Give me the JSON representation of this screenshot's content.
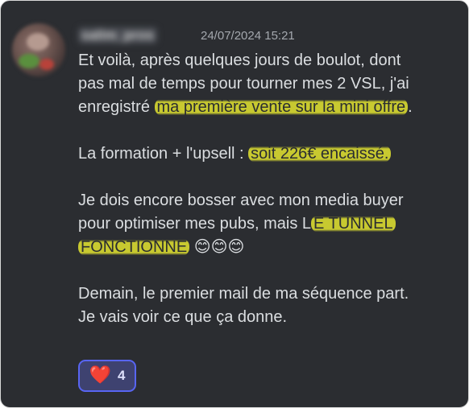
{
  "message": {
    "author": "salim_pros",
    "timestamp": "24/07/2024 15:21",
    "lines": [
      {
        "segments": [
          {
            "text": "Et voilà, après quelques jours de boulot, dont",
            "highlight": false
          }
        ]
      },
      {
        "segments": [
          {
            "text": "pas mal de temps pour tourner mes 2 VSL, j'ai",
            "highlight": false
          }
        ]
      },
      {
        "segments": [
          {
            "text": "enregistré ",
            "highlight": false
          },
          {
            "text": "ma première vente sur la mini offre",
            "highlight": true
          },
          {
            "text": ".",
            "highlight": false
          }
        ]
      },
      {
        "blank": true
      },
      {
        "segments": [
          {
            "text": "La formation + l'upsell : ",
            "highlight": false
          },
          {
            "text": "soit 226€ encaissé.",
            "highlight": true
          }
        ]
      },
      {
        "blank": true
      },
      {
        "segments": [
          {
            "text": "Je dois encore bosser avec mon media buyer",
            "highlight": false
          }
        ]
      },
      {
        "segments": [
          {
            "text": "pour optimiser mes pubs,  mais L",
            "highlight": false
          },
          {
            "text": "E TUNNEL",
            "highlight": true
          }
        ]
      },
      {
        "segments": [
          {
            "text": "FONCTIONNE",
            "highlight": true
          },
          {
            "text": " 😊😊😊",
            "highlight": false
          }
        ]
      },
      {
        "blank": true
      },
      {
        "segments": [
          {
            "text": "Demain, le premier mail de ma séquence part.",
            "highlight": false
          }
        ]
      },
      {
        "segments": [
          {
            "text": "Je vais voir ce que ça donne.",
            "highlight": false
          }
        ]
      }
    ]
  },
  "reaction": {
    "icon": "heart-icon",
    "emoji": "❤️",
    "count": "4"
  },
  "colors": {
    "background": "#2b2d31",
    "text": "#dbdee1",
    "timestamp": "#a4a8ae",
    "highlight": "#d5d630",
    "reaction_bg": "#3e4270",
    "reaction_border": "#5865f2"
  }
}
